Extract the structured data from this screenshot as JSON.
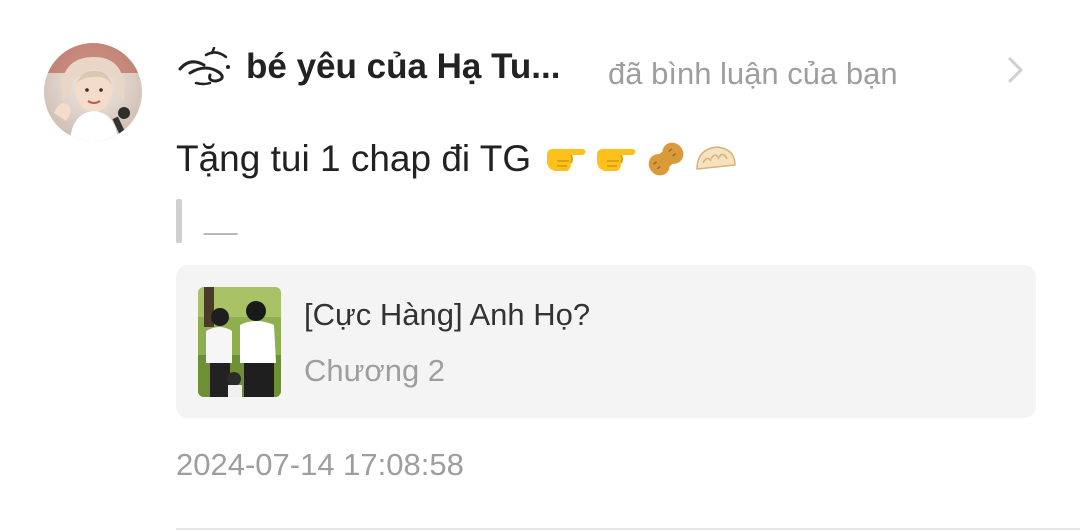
{
  "notification": {
    "user": {
      "name": "bé yêu của Hạ Tu...",
      "avatar_icon": "avatar-photo",
      "name_decoration_icon": "swirl-decoration-icon"
    },
    "action_text": "đã bình luận của bạn",
    "comment": {
      "text": "Tặng tui 1 chap đi TG",
      "emojis": [
        "backhand-index-pointing-right",
        "backhand-index-pointing-right",
        "peanuts",
        "dumpling"
      ]
    },
    "quote": {
      "text": "__"
    },
    "story_card": {
      "title": "[Cực Hàng] Anh Họ?",
      "chapter": "Chương 2",
      "thumbnail_icon": "story-cover-thumbnail"
    },
    "timestamp": "2024-07-14 17:08:58",
    "colors": {
      "primary_text": "#222222",
      "secondary_text": "#9e9e9e",
      "card_background": "#f4f4f5",
      "quote_bar": "#d0d0d0"
    }
  }
}
